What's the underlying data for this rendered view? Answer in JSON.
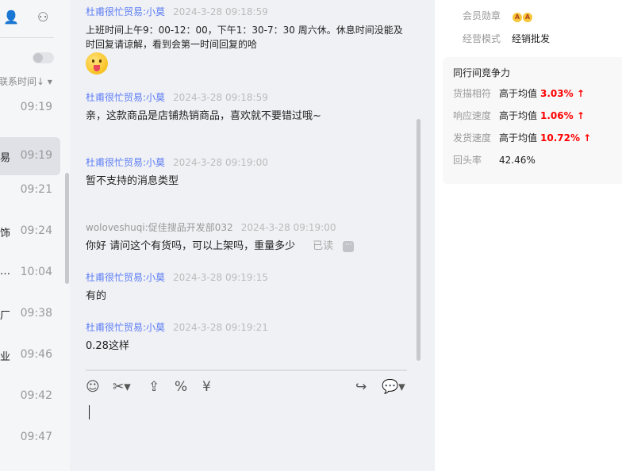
{
  "sidebar": {
    "sort_label": "联系时间↓ ▾",
    "conversations": [
      {
        "name": "",
        "time": "09:19"
      },
      {
        "name": "易",
        "time": "09:19",
        "selected": true
      },
      {
        "name": "",
        "time": "09:21"
      },
      {
        "name": "饰",
        "time": "09:24"
      },
      {
        "name": "…",
        "time": "10:04"
      },
      {
        "name": "厂",
        "time": "09:38"
      },
      {
        "name": "业",
        "time": "09:46"
      },
      {
        "name": "",
        "time": "09:42"
      },
      {
        "name": "",
        "time": "09:47"
      }
    ]
  },
  "chat": {
    "messages": [
      {
        "sender": "杜甫很忙贸易:小莫",
        "time": "2024-3-28 09:18:59",
        "text": "上班时间上午9：00-12：00，下午1：30-7：30 周六休。休息时间没能及时回复请谅解，看到会第一时间回复的哈"
      },
      {
        "sender": "杜甫很忙贸易:小莫",
        "time": "2024-3-28 09:18:59",
        "text": "亲，这款商品是店铺热销商品，喜欢就不要错过哦~"
      },
      {
        "sender": "杜甫很忙贸易:小莫",
        "time": "2024-3-28 09:19:00",
        "text": "暂不支持的消息类型"
      },
      {
        "sender": "woloveshuqi:促佳搜品开发部032",
        "time": "2024-3-28 09:19:00",
        "text": "你好 请问这个有货吗，可以上架吗，重量多少",
        "status": "已读"
      },
      {
        "sender": "杜甫很忙贸易:小莫",
        "time": "2024-3-28 09:19:15",
        "text": "有的"
      },
      {
        "sender": "杜甫很忙贸易:小莫",
        "time": "2024-3-28 09:19:21",
        "text": "0.28这样"
      }
    ],
    "more_label": "···"
  },
  "shop": {
    "medal_label": "会员勋章",
    "medal_badge": "A",
    "mode_label": "经营模式",
    "mode_value": "经销批发",
    "competition": {
      "title": "同行间竞争力",
      "rows": [
        {
          "label": "货描相符",
          "value": "高于均值",
          "pct": "3.03% ↑"
        },
        {
          "label": "响应速度",
          "value": "高于均值",
          "pct": "1.06% ↑"
        },
        {
          "label": "发货速度",
          "value": "高于均值",
          "pct": "10.72% ↑"
        }
      ],
      "repeat_label": "回头率",
      "repeat_value": "42.46%"
    }
  }
}
